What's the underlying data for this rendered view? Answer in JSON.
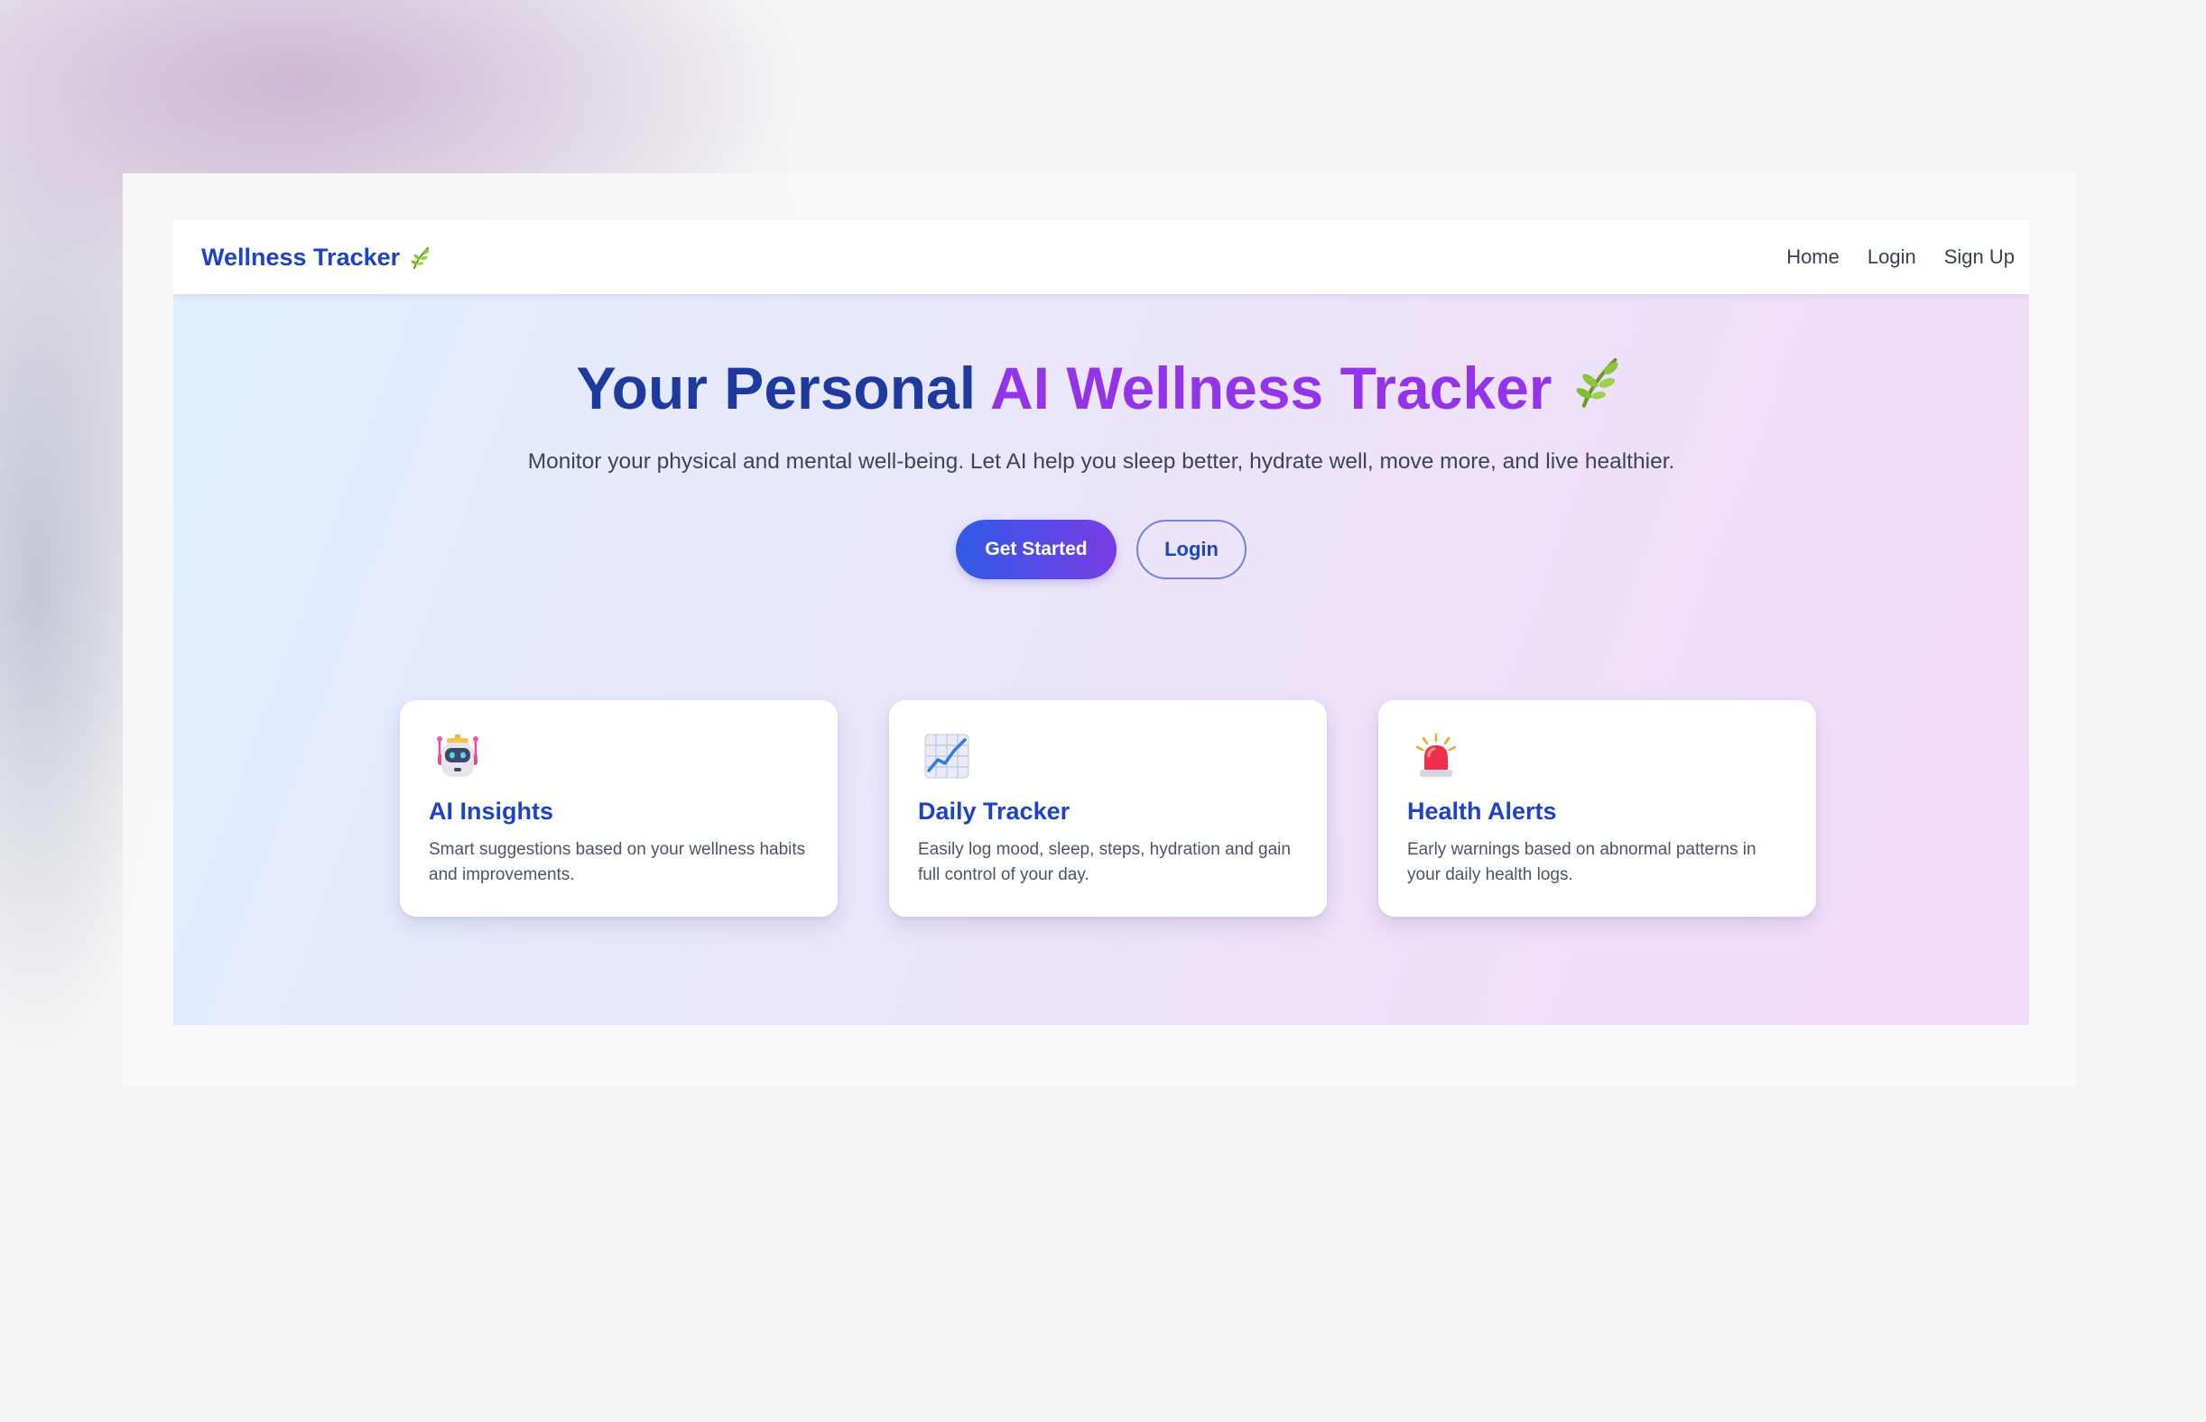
{
  "nav": {
    "brand": "Wellness Tracker",
    "brand_icon": "herb-leaf-icon",
    "links": [
      "Home",
      "Login",
      "Sign Up"
    ]
  },
  "hero": {
    "title_part1": "Your Personal",
    "title_part2": "AI Wellness Tracker",
    "title_icon": "herb-leaf-icon",
    "subtitle": "Monitor your physical and mental well-being. Let AI help you sleep better, hydrate well, move more, and live healthier.",
    "primary_button": "Get Started",
    "secondary_button": "Login"
  },
  "features": [
    {
      "icon": "robot-icon",
      "title": "AI Insights",
      "description": "Smart suggestions based on your wellness habits and improvements."
    },
    {
      "icon": "chart-increasing-icon",
      "title": "Daily Tracker",
      "description": "Easily log mood, sleep, steps, hydration and gain full control of your day."
    },
    {
      "icon": "siren-alert-icon",
      "title": "Health Alerts",
      "description": "Early warnings based on abnormal patterns in your daily health logs."
    }
  ],
  "colors": {
    "brand_blue": "#1d44c4",
    "title_dark_blue": "#1e3a9e",
    "title_purple": "#9333ea",
    "button_gradient_start": "#2f5be6",
    "button_gradient_end": "#7b3be6"
  }
}
